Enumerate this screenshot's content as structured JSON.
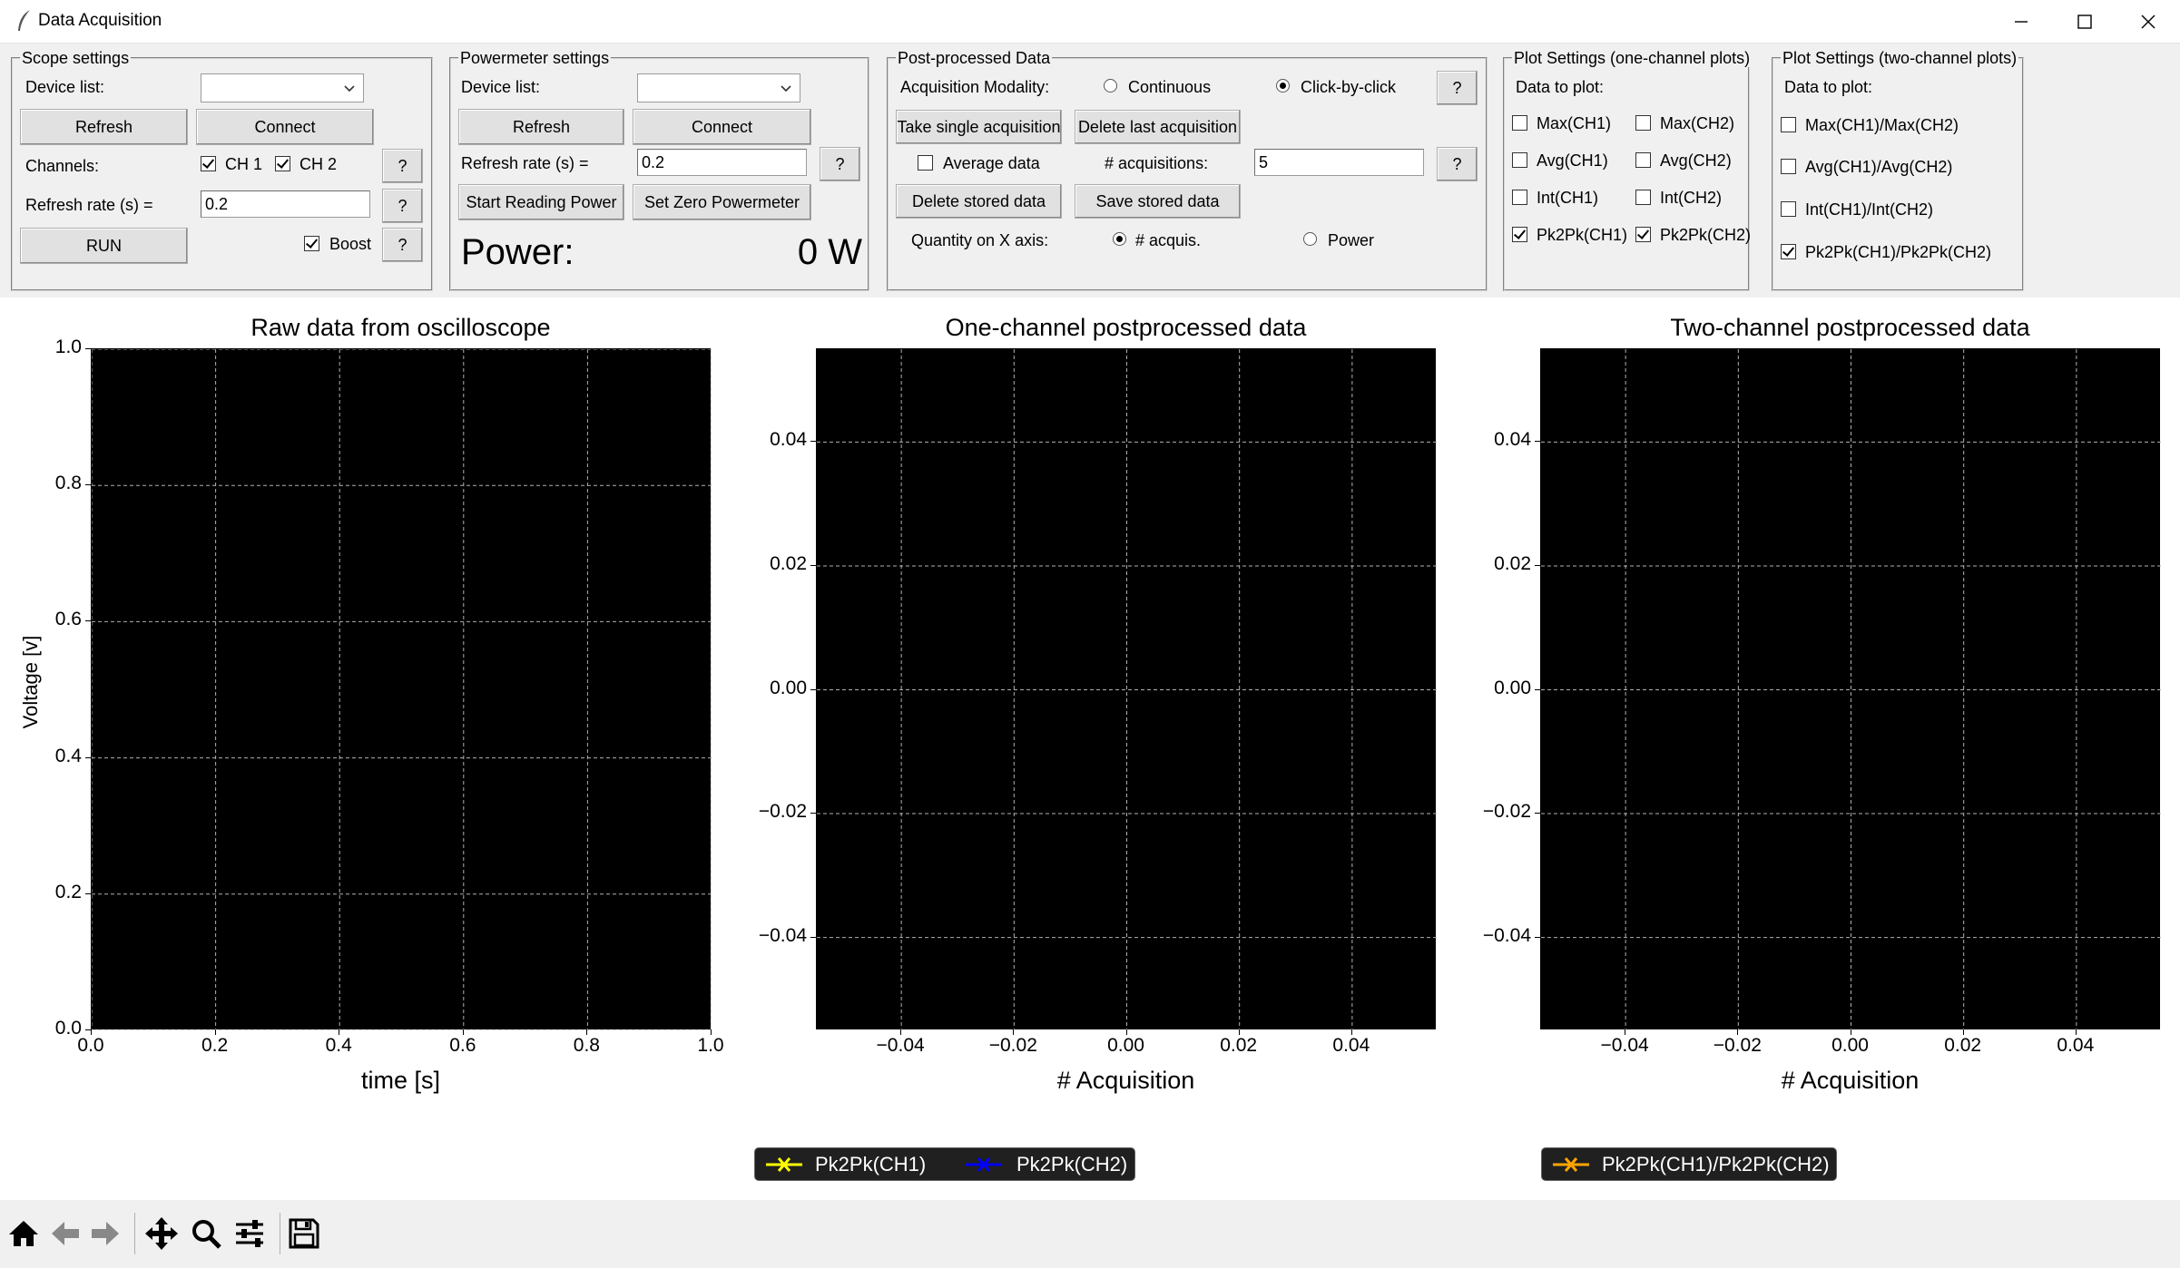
{
  "window": {
    "title": "Data Acquisition",
    "controls": [
      "minimize",
      "maximize",
      "close"
    ]
  },
  "scope": {
    "group_title": "Scope settings",
    "device_list_label": "Device list:",
    "device_list_value": "",
    "refresh_label": "Refresh",
    "connect_label": "Connect",
    "channels_label": "Channels:",
    "ch1_label": "CH 1",
    "ch1_checked": true,
    "ch2_label": "CH 2",
    "ch2_checked": true,
    "refresh_rate_label": "Refresh rate (s) =",
    "refresh_rate_value": "0.2",
    "run_label": "RUN",
    "boost_label": "Boost",
    "boost_checked": true,
    "help_label": "?"
  },
  "powermeter": {
    "group_title": "Powermeter settings",
    "device_list_label": "Device list:",
    "device_list_value": "",
    "refresh_label": "Refresh",
    "connect_label": "Connect",
    "refresh_rate_label": "Refresh rate (s) =",
    "refresh_rate_value": "0.2",
    "start_label": "Start Reading Power",
    "zero_label": "Set Zero Powermeter",
    "power_label": "Power:",
    "power_value": "0 W",
    "help_label": "?"
  },
  "postprocess": {
    "group_title": "Post-processed Data",
    "modality_label": "Acquisition Modality:",
    "continuous_label": "Continuous",
    "clickbyclick_label": "Click-by-click",
    "modality_selected": "Click-by-click",
    "take_single_label": "Take single acquisition",
    "delete_last_label": "Delete last acquisition",
    "average_label": "Average data",
    "average_checked": false,
    "n_acq_label": "# acquisitions:",
    "n_acq_value": "5",
    "delete_stored_label": "Delete stored data",
    "save_stored_label": "Save stored data",
    "xaxis_label": "Quantity on X axis:",
    "xaxis_acquis_label": "# acquis.",
    "xaxis_power_label": "Power",
    "xaxis_selected": "# acquis.",
    "help_label": "?"
  },
  "plot_one": {
    "group_title": "Plot Settings (one-channel plots)",
    "data_label": "Data to plot:",
    "options": [
      {
        "label": "Max(CH1)",
        "checked": false
      },
      {
        "label": "Max(CH2)",
        "checked": false
      },
      {
        "label": "Avg(CH1)",
        "checked": false
      },
      {
        "label": "Avg(CH2)",
        "checked": false
      },
      {
        "label": "Int(CH1)",
        "checked": false
      },
      {
        "label": "Int(CH2)",
        "checked": false
      },
      {
        "label": "Pk2Pk(CH1)",
        "checked": true
      },
      {
        "label": "Pk2Pk(CH2)",
        "checked": true
      }
    ]
  },
  "plot_two": {
    "group_title": "Plot Settings (two-channel plots)",
    "data_label": "Data to plot:",
    "options": [
      {
        "label": "Max(CH1)/Max(CH2)",
        "checked": false
      },
      {
        "label": "Avg(CH1)/Avg(CH2)",
        "checked": false
      },
      {
        "label": "Int(CH1)/Int(CH2)",
        "checked": false
      },
      {
        "label": "Pk2Pk(CH1)/Pk2Pk(CH2)",
        "checked": true
      }
    ]
  },
  "chart_data": [
    {
      "type": "line",
      "title": "Raw data from oscilloscope",
      "xlabel": "time [s]",
      "ylabel": "Voltage [v]",
      "xlim": [
        0.0,
        1.0
      ],
      "ylim": [
        0.0,
        1.0
      ],
      "xticks": [
        "0.0",
        "0.2",
        "0.4",
        "0.6",
        "0.8",
        "1.0"
      ],
      "yticks": [
        "0.0",
        "0.2",
        "0.4",
        "0.6",
        "0.8",
        "1.0"
      ],
      "grid": true,
      "background": "#000000",
      "series": []
    },
    {
      "type": "line",
      "title": "One-channel postprocessed data",
      "xlabel": "# Acquisition",
      "ylabel": "",
      "xlim": [
        -0.055,
        0.055
      ],
      "ylim": [
        -0.055,
        0.055
      ],
      "xticks": [
        "−0.04",
        "−0.02",
        "0.00",
        "0.02",
        "0.04"
      ],
      "yticks": [
        "−0.04",
        "−0.02",
        "0.00",
        "0.02",
        "0.04"
      ],
      "grid": true,
      "background": "#000000",
      "series": [
        {
          "name": "Pk2Pk(CH1)",
          "color": "#ffff00",
          "values": []
        },
        {
          "name": "Pk2Pk(CH2)",
          "color": "#0000ff",
          "values": []
        }
      ],
      "legend": "bottom-center"
    },
    {
      "type": "line",
      "title": "Two-channel postprocessed data",
      "xlabel": "# Acquisition",
      "ylabel": "",
      "xlim": [
        -0.055,
        0.055
      ],
      "ylim": [
        -0.055,
        0.055
      ],
      "xticks": [
        "−0.04",
        "−0.02",
        "0.00",
        "0.02",
        "0.04"
      ],
      "yticks": [
        "−0.04",
        "−0.02",
        "0.00",
        "0.02",
        "0.04"
      ],
      "grid": true,
      "background": "#000000",
      "series": [
        {
          "name": "Pk2Pk(CH1)/Pk2Pk(CH2)",
          "color": "#ffa500",
          "values": []
        }
      ],
      "legend": "bottom-center"
    }
  ],
  "toolbar": {
    "tools": [
      "home-icon",
      "back-icon",
      "forward-icon",
      "pan-icon",
      "zoom-icon",
      "configure-icon",
      "save-icon"
    ]
  }
}
